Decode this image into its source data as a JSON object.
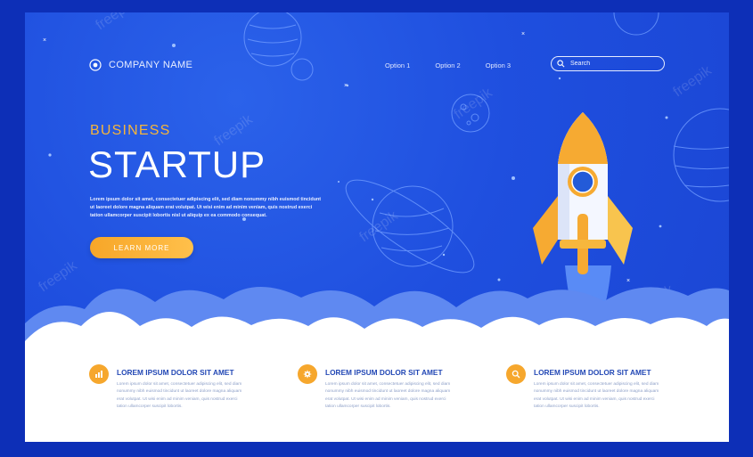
{
  "brand": {
    "name": "COMPANY NAME",
    "icon": "target-icon"
  },
  "nav": [
    {
      "label": "Option 1"
    },
    {
      "label": "Option 2"
    },
    {
      "label": "Option 3"
    }
  ],
  "search": {
    "placeholder": "Search",
    "icon": "search-icon"
  },
  "hero": {
    "kicker": "BUSINESS",
    "title": "STARTUP",
    "text": "Lorem ipsum dolor sit amet, consectetuer adipiscing elit, sed diam nonummy nibh euismod tincidunt ut laoreet dolore magna aliquam erat volutpat. Ut wisi enim ad minim veniam, quis nostrud exerci tation ullamcorper suscipit lobortis nisl ut aliquip ex ea commodo consequat.",
    "cta": "LEARN MORE"
  },
  "features": [
    {
      "icon": "bar-chart-icon",
      "title": "LOREM IPSUM DOLOR SIT AMET",
      "text": "Lorem ipsum dolor sit amet, consectetuer adipiscing elit, sed diam nonummy nibh euismod tincidunt ut laoreet dolore magna aliquam erat volutpat. Ut wisi enim ad minim veniam, quis nostrud exerci tation ullamcorper suscipit lobortis."
    },
    {
      "icon": "gear-icon",
      "title": "LOREM IPSUM DOLOR SIT AMET",
      "text": "Lorem ipsum dolor sit amet, consectetuer adipiscing elit, sed diam nonummy nibh euismod tincidunt ut laoreet dolore magna aliquam erat volutpat. Ut wisi enim ad minim veniam, quis nostrud exerci tation ullamcorper suscipit lobortis."
    },
    {
      "icon": "magnifier-icon",
      "title": "LOREM IPSUM DOLOR SIT AMET",
      "text": "Lorem ipsum dolor sit amet, consectetuer adipiscing elit, sed diam nonummy nibh euismod tincidunt ut laoreet dolore magna aliquam erat volutpat. Ut wisi enim ad minim veniam, quis nostrud exerci tation ullamcorper suscipit lobortis."
    }
  ],
  "watermark": "freepik",
  "colors": {
    "background": "#1f4fdf",
    "accent": "#f6a72d",
    "heading": "#2348b5"
  }
}
